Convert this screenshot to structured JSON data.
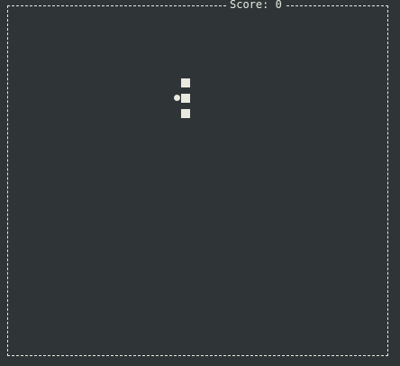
{
  "game": {
    "score_label": "Score: 0",
    "score": 0,
    "colors": {
      "background": "#2f3537",
      "foreground": "#e9e9e0"
    },
    "pieces": [
      "block",
      "block",
      "block",
      "dot"
    ]
  }
}
